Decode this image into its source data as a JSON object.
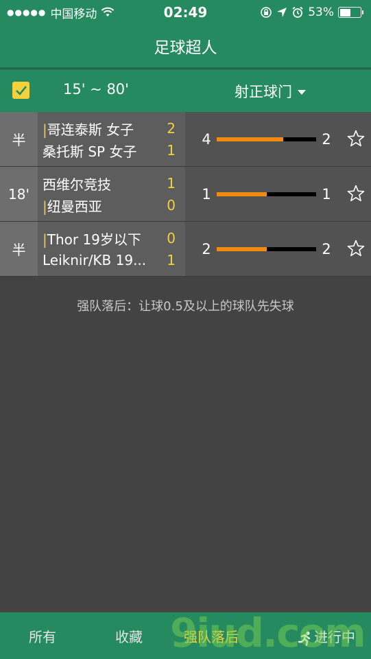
{
  "status_bar": {
    "signal": "●●●●●",
    "carrier": "中国移动",
    "time": "02:49",
    "battery_text": "53%",
    "battery_level": 0.53
  },
  "nav": {
    "title": "足球超人"
  },
  "filter": {
    "checked": true,
    "time_range": "15' ~ 80'",
    "stat_type": "射正球门"
  },
  "matches": [
    {
      "status": "半",
      "home": "哥连泰斯 女子",
      "home_mark": "|",
      "home_score": "2",
      "away": "桑托斯 SP 女子",
      "away_mark": "",
      "away_score": "1",
      "stat_left": "4",
      "stat_right": "2",
      "ratio": 0.67
    },
    {
      "status": "18'",
      "home": "西维尔竞技",
      "home_mark": "",
      "home_score": "1",
      "away": "纽曼西亚",
      "away_mark": "|",
      "away_score": "0",
      "stat_left": "1",
      "stat_right": "1",
      "ratio": 0.5
    },
    {
      "status": "半",
      "home": "Thor 19岁以下",
      "home_mark": "|",
      "home_score": "0",
      "away": "Leiknir/KB 19...",
      "away_mark": "",
      "away_score": "1",
      "stat_left": "2",
      "stat_right": "2",
      "ratio": 0.5
    }
  ],
  "hint": "强队落后：让球0.5及以上的球队先失球",
  "tabs": {
    "all": "所有",
    "favorites": "收藏",
    "strong_behind": "强队落后",
    "live": "进行中"
  },
  "watermark": "9iud.com",
  "colors": {
    "green": "#258a5f",
    "yellow": "#f4d23e",
    "orange": "#f18c0e"
  }
}
